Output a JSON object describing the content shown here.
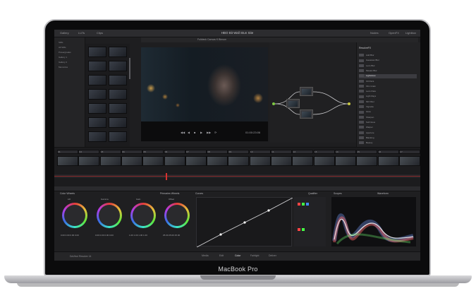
{
  "laptop": {
    "model_label": "MacBook Pro"
  },
  "app": {
    "title": "HBO Bit Wall Stun Site",
    "topbar_left": [
      "Gallery",
      "LUTs",
      "Clips"
    ],
    "topbar_right": [
      "Nodes",
      "OpenFX",
      "Lightbox"
    ],
    "viewer_title": "Fulldeck Canvas K Binson",
    "timecode": "01:00:23:06",
    "transport_labels": [
      "◀◀",
      "◀",
      "■",
      "▶",
      "▶▶",
      "⟳"
    ],
    "left_panel_items": [
      "Stills",
      "All Stills",
      "Powergrades",
      "Gallery 1",
      "Gallery 2",
      "Memories"
    ],
    "right_panel_title": "ResolveFX",
    "right_panel_items": [
      "Add Blur",
      "Gaussian Blur",
      "Lens Blur",
      "Mosaic Blur",
      "Lightshow",
      "Oil Paint",
      "Film Grain",
      "Lens Flare",
      "Light Rays",
      "ND Filter",
      "Vignette",
      "Glow",
      "Sharpen",
      "Soft Glow",
      "Warper",
      "Aperture",
      "Blanking",
      "Beauty"
    ],
    "right_panel_selected": 4,
    "colorpanel_title": "Color Wheels",
    "primaries_title": "Primaries Wheels",
    "curves_title": "Curves",
    "qualifier_title": "Qualifier",
    "scope_title": "Scopes",
    "scope_mode": "Waveform",
    "wheels": [
      {
        "label": "Lift",
        "values": "0.00  0.00  0.00  0.00"
      },
      {
        "label": "Gamma",
        "values": "0.00  0.00  0.00  0.00"
      },
      {
        "label": "Gain",
        "values": "1.00  1.00  1.00  1.00"
      },
      {
        "label": "Offset",
        "values": "25.00  25.00  25.00"
      }
    ],
    "bottom_pages": [
      "Media",
      "Edit",
      "Color",
      "Fairlight",
      "Deliver"
    ],
    "bottom_app_label": "DaVinci Resolve 14",
    "timeline_clip_numbers": [
      "01",
      "02",
      "03",
      "04",
      "05",
      "06",
      "07",
      "08",
      "09",
      "10",
      "11",
      "12",
      "13",
      "14",
      "15",
      "16",
      "17"
    ]
  }
}
